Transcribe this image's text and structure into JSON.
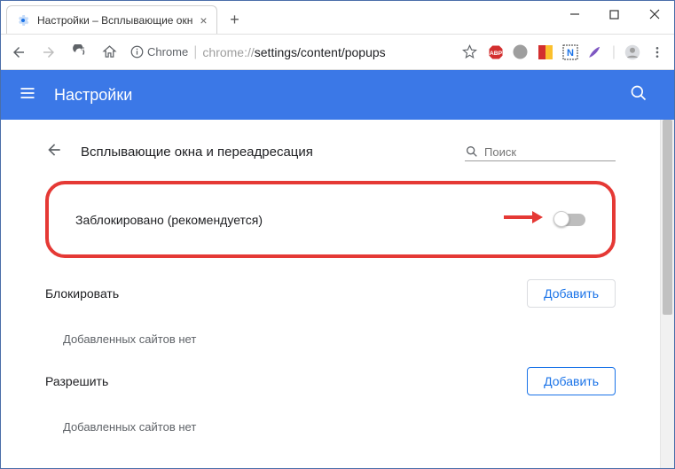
{
  "window": {
    "tab_title": "Настройки – Всплывающие окн"
  },
  "addressbar": {
    "secure_label": "Chrome",
    "url_prefix": "chrome://",
    "url_path": "settings/content/popups"
  },
  "header": {
    "title": "Настройки"
  },
  "subheader": {
    "title": "Всплывающие окна и переадресация",
    "search_placeholder": "Поиск"
  },
  "toggle": {
    "label": "Заблокировано (рекомендуется)"
  },
  "sections": {
    "block": {
      "title": "Блокировать",
      "add_btn": "Добавить",
      "empty": "Добавленных сайтов нет"
    },
    "allow": {
      "title": "Разрешить",
      "add_btn": "Добавить",
      "empty": "Добавленных сайтов нет"
    }
  }
}
